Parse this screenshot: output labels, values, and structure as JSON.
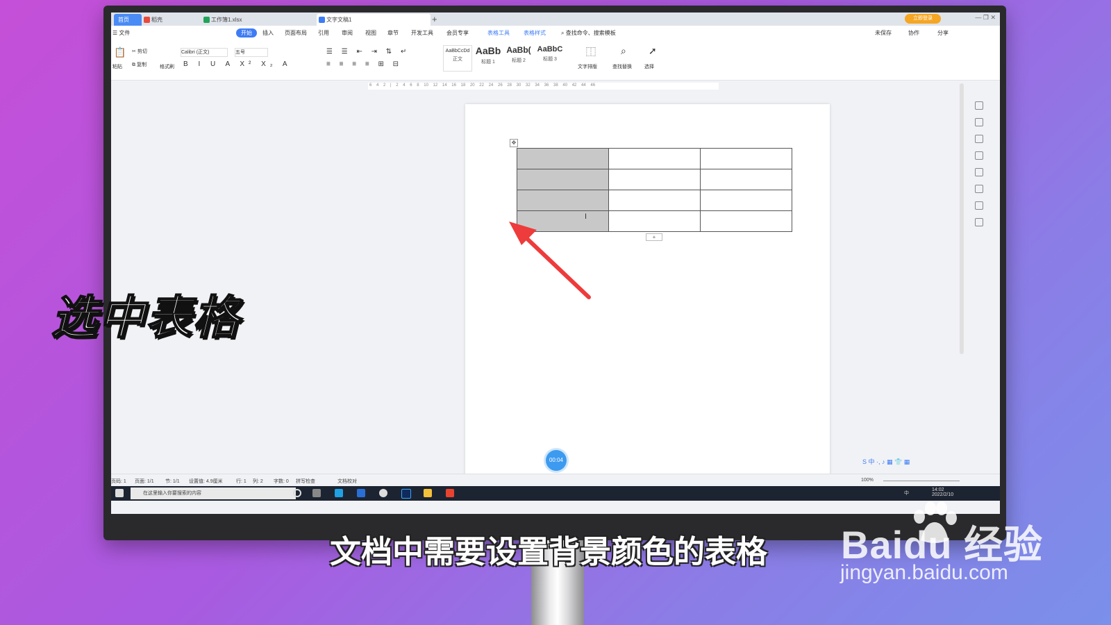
{
  "tabs": {
    "home": "首页",
    "docer": "稻壳",
    "xlsx": "工作簿1.xlsx",
    "doc": "文字文稿1",
    "new_tab": "+"
  },
  "header": {
    "login": "立即登录",
    "window_controls": "— ❐ ✕"
  },
  "menu": {
    "file": "☰ 文件",
    "start": "开始",
    "insert": "插入",
    "layout": "页面布局",
    "reference": "引用",
    "review": "审阅",
    "view": "视图",
    "chapter": "章节",
    "devtools": "开发工具",
    "member": "会员专享",
    "table_tools": "表格工具",
    "table_style": "表格样式",
    "search": "查找命令、搜索模板",
    "unsaved": "未保存",
    "collab": "协作",
    "share": "分享"
  },
  "ribbon": {
    "paste": "粘贴",
    "cut": "剪切",
    "copy": "复制",
    "format_painter": "格式刷",
    "font": "Calibri (正文)",
    "size": "五号",
    "styles": [
      {
        "preview": "AaBbCcDd",
        "name": "正文"
      },
      {
        "preview": "AaBb",
        "name": "标题 1"
      },
      {
        "preview": "AaBb(",
        "name": "标题 2"
      },
      {
        "preview": "AaBbC",
        "name": "标题 3"
      }
    ],
    "text_layout": "文字排版",
    "find_replace": "查找替换",
    "select": "选择"
  },
  "ruler": {
    "ticks": "6 4 2 | 2 4 6 8 10 12 14 16 18 20 22 24 26 28 30 32 34 36 38 40 42 44 46"
  },
  "document": {
    "table": {
      "rows": 4,
      "cols": 3,
      "selected_col": 0
    },
    "add_row": "+",
    "cursor": "I"
  },
  "timer": "00:04",
  "status": {
    "page_num": "页码: 1",
    "page": "页面: 1/1",
    "section": "节: 1/1",
    "setting": "设置值: 4.9厘米",
    "row": "行: 1",
    "col": "列: 2",
    "words": "字数: 0",
    "spell": "拼写检查",
    "proof": "文档校对",
    "zoom": "100%"
  },
  "ime": "S 中 ·, ♪ ▦ 👕 ▦",
  "taskbar": {
    "search": "在这里输入你要搜索的内容",
    "time": "14:02",
    "date": "2022/2/10",
    "lang": "中"
  },
  "overlay": {
    "left_caption": "选中表格",
    "subtitle": "文档中需要设置背景颜色的表格",
    "watermark": "Baidu 经验",
    "watermark_url": "jingyan.baidu.com"
  }
}
